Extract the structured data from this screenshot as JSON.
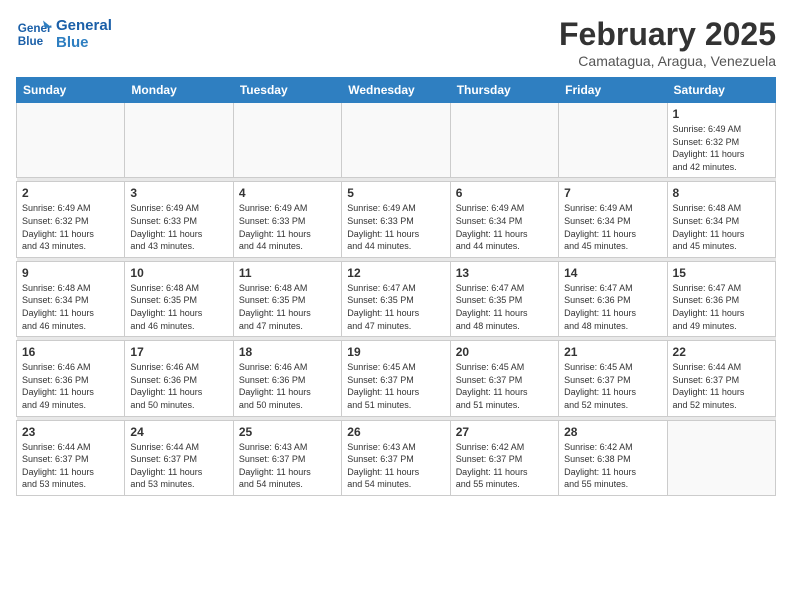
{
  "logo": {
    "line1": "General",
    "line2": "Blue"
  },
  "title": "February 2025",
  "subtitle": "Camatagua, Aragua, Venezuela",
  "weekdays": [
    "Sunday",
    "Monday",
    "Tuesday",
    "Wednesday",
    "Thursday",
    "Friday",
    "Saturday"
  ],
  "weeks": [
    [
      {
        "day": "",
        "info": ""
      },
      {
        "day": "",
        "info": ""
      },
      {
        "day": "",
        "info": ""
      },
      {
        "day": "",
        "info": ""
      },
      {
        "day": "",
        "info": ""
      },
      {
        "day": "",
        "info": ""
      },
      {
        "day": "1",
        "info": "Sunrise: 6:49 AM\nSunset: 6:32 PM\nDaylight: 11 hours\nand 42 minutes."
      }
    ],
    [
      {
        "day": "2",
        "info": "Sunrise: 6:49 AM\nSunset: 6:32 PM\nDaylight: 11 hours\nand 43 minutes."
      },
      {
        "day": "3",
        "info": "Sunrise: 6:49 AM\nSunset: 6:33 PM\nDaylight: 11 hours\nand 43 minutes."
      },
      {
        "day": "4",
        "info": "Sunrise: 6:49 AM\nSunset: 6:33 PM\nDaylight: 11 hours\nand 44 minutes."
      },
      {
        "day": "5",
        "info": "Sunrise: 6:49 AM\nSunset: 6:33 PM\nDaylight: 11 hours\nand 44 minutes."
      },
      {
        "day": "6",
        "info": "Sunrise: 6:49 AM\nSunset: 6:34 PM\nDaylight: 11 hours\nand 44 minutes."
      },
      {
        "day": "7",
        "info": "Sunrise: 6:49 AM\nSunset: 6:34 PM\nDaylight: 11 hours\nand 45 minutes."
      },
      {
        "day": "8",
        "info": "Sunrise: 6:48 AM\nSunset: 6:34 PM\nDaylight: 11 hours\nand 45 minutes."
      }
    ],
    [
      {
        "day": "9",
        "info": "Sunrise: 6:48 AM\nSunset: 6:34 PM\nDaylight: 11 hours\nand 46 minutes."
      },
      {
        "day": "10",
        "info": "Sunrise: 6:48 AM\nSunset: 6:35 PM\nDaylight: 11 hours\nand 46 minutes."
      },
      {
        "day": "11",
        "info": "Sunrise: 6:48 AM\nSunset: 6:35 PM\nDaylight: 11 hours\nand 47 minutes."
      },
      {
        "day": "12",
        "info": "Sunrise: 6:47 AM\nSunset: 6:35 PM\nDaylight: 11 hours\nand 47 minutes."
      },
      {
        "day": "13",
        "info": "Sunrise: 6:47 AM\nSunset: 6:35 PM\nDaylight: 11 hours\nand 48 minutes."
      },
      {
        "day": "14",
        "info": "Sunrise: 6:47 AM\nSunset: 6:36 PM\nDaylight: 11 hours\nand 48 minutes."
      },
      {
        "day": "15",
        "info": "Sunrise: 6:47 AM\nSunset: 6:36 PM\nDaylight: 11 hours\nand 49 minutes."
      }
    ],
    [
      {
        "day": "16",
        "info": "Sunrise: 6:46 AM\nSunset: 6:36 PM\nDaylight: 11 hours\nand 49 minutes."
      },
      {
        "day": "17",
        "info": "Sunrise: 6:46 AM\nSunset: 6:36 PM\nDaylight: 11 hours\nand 50 minutes."
      },
      {
        "day": "18",
        "info": "Sunrise: 6:46 AM\nSunset: 6:36 PM\nDaylight: 11 hours\nand 50 minutes."
      },
      {
        "day": "19",
        "info": "Sunrise: 6:45 AM\nSunset: 6:37 PM\nDaylight: 11 hours\nand 51 minutes."
      },
      {
        "day": "20",
        "info": "Sunrise: 6:45 AM\nSunset: 6:37 PM\nDaylight: 11 hours\nand 51 minutes."
      },
      {
        "day": "21",
        "info": "Sunrise: 6:45 AM\nSunset: 6:37 PM\nDaylight: 11 hours\nand 52 minutes."
      },
      {
        "day": "22",
        "info": "Sunrise: 6:44 AM\nSunset: 6:37 PM\nDaylight: 11 hours\nand 52 minutes."
      }
    ],
    [
      {
        "day": "23",
        "info": "Sunrise: 6:44 AM\nSunset: 6:37 PM\nDaylight: 11 hours\nand 53 minutes."
      },
      {
        "day": "24",
        "info": "Sunrise: 6:44 AM\nSunset: 6:37 PM\nDaylight: 11 hours\nand 53 minutes."
      },
      {
        "day": "25",
        "info": "Sunrise: 6:43 AM\nSunset: 6:37 PM\nDaylight: 11 hours\nand 54 minutes."
      },
      {
        "day": "26",
        "info": "Sunrise: 6:43 AM\nSunset: 6:37 PM\nDaylight: 11 hours\nand 54 minutes."
      },
      {
        "day": "27",
        "info": "Sunrise: 6:42 AM\nSunset: 6:37 PM\nDaylight: 11 hours\nand 55 minutes."
      },
      {
        "day": "28",
        "info": "Sunrise: 6:42 AM\nSunset: 6:38 PM\nDaylight: 11 hours\nand 55 minutes."
      },
      {
        "day": "",
        "info": ""
      }
    ]
  ]
}
